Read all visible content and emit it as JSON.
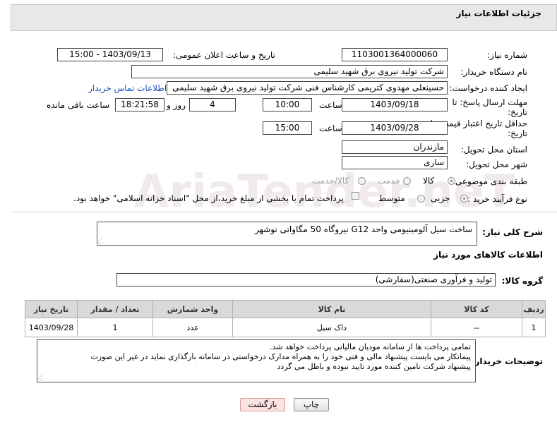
{
  "header": {
    "title": "جزئیات اطلاعات نیاز"
  },
  "fields": {
    "need_number": {
      "label": "شماره نیاز:",
      "value": "1103001364000060"
    },
    "announce_datetime": {
      "label": "تاریخ و ساعت اعلان عمومی:",
      "value": "1403/09/13 - 15:00"
    },
    "buyer_org": {
      "label": "نام دستگاه خریدار:",
      "value": "شرکت تولید نیروی برق شهید سلیمی"
    },
    "creator": {
      "label": "ایجاد کننده درخواست:",
      "value": "حسینعلی مهدوی کتریمی کارشناس فنی شرکت تولید نیروی برق شهید سلیمی",
      "contact_link": "اطلاعات تماس خریدار"
    },
    "deadline": {
      "label_line1": "مهلت ارسال پاسخ: تا",
      "label_line2": "تاریخ:",
      "date": "1403/09/18",
      "time_label": "ساعت",
      "time": "10:00",
      "days": "4",
      "days_label": "روز و",
      "remaining": "18:21:58",
      "remaining_label": "ساعت باقی مانده"
    },
    "price_validity": {
      "label_line1": "حداقل تاریخ اعتبار قیمت: تا",
      "label_line2": "تاریخ:",
      "date": "1403/09/28",
      "time_label": "ساعت",
      "time": "15:00"
    },
    "delivery_province": {
      "label": "استان محل تحویل:",
      "value": "مازندران"
    },
    "delivery_city": {
      "label": "شهر محل تحویل:",
      "value": "ساری"
    },
    "category": {
      "label": "طبقه بندی موضوعی:",
      "options": [
        "کالا",
        "خدمت",
        "کالا/خدمت"
      ],
      "selected": "کالا"
    },
    "purchase_type": {
      "label": "نوع فرآیند خرید :",
      "options": [
        "جزیی",
        "متوسط"
      ],
      "note": "پرداخت تمام یا بخشی از مبلغ خرید،از محل \"اسناد خزانه اسلامی\" خواهد بود."
    },
    "description": {
      "label": "شرح کلی نیاز:",
      "value": "ساخت سیل آلومینیومی واحد G12 نیروگاه 50 مگاواتی نوشهر"
    }
  },
  "goods_section": {
    "title": "اطلاعات کالاهای مورد نیاز",
    "group_label": "گروه کالا:",
    "group_value": "تولید و فرآوری صنعتی(سفارشی)"
  },
  "table": {
    "headers": [
      "ردیف",
      "کد کالا",
      "نام کالا",
      "واحد شمارش",
      "تعداد / مقدار",
      "تاریخ نیاز"
    ],
    "rows": [
      [
        "1",
        "--",
        "داک سیل",
        "عدد",
        "1",
        "1403/09/28"
      ]
    ]
  },
  "buyer_notes": {
    "label": "توضیحات خریدار:",
    "line1": "تمامی پرداخت ها از سامانه مودیان مالیاتی پرداخت خواهد شد.",
    "line2": "پیمانکار می بایست پیشنهاد مالی و فنی خود را به همراه مدارک درخواستی در سامانه بارگذاری نماید در غیر این صورت",
    "line3": "پیشنهاد شرکت تامین کننده مورد تایید نبوده و باطل می گردد"
  },
  "buttons": {
    "print": "چاپ",
    "back": "بازگشت"
  },
  "watermark": {
    "text": "AriaTender.neT"
  },
  "colors": {
    "link": "#1a4fb5",
    "panel_bg": "#e8e8e8",
    "table_header_bg": "#d9d9d9",
    "back_button_bg": "#fbe3e3"
  }
}
